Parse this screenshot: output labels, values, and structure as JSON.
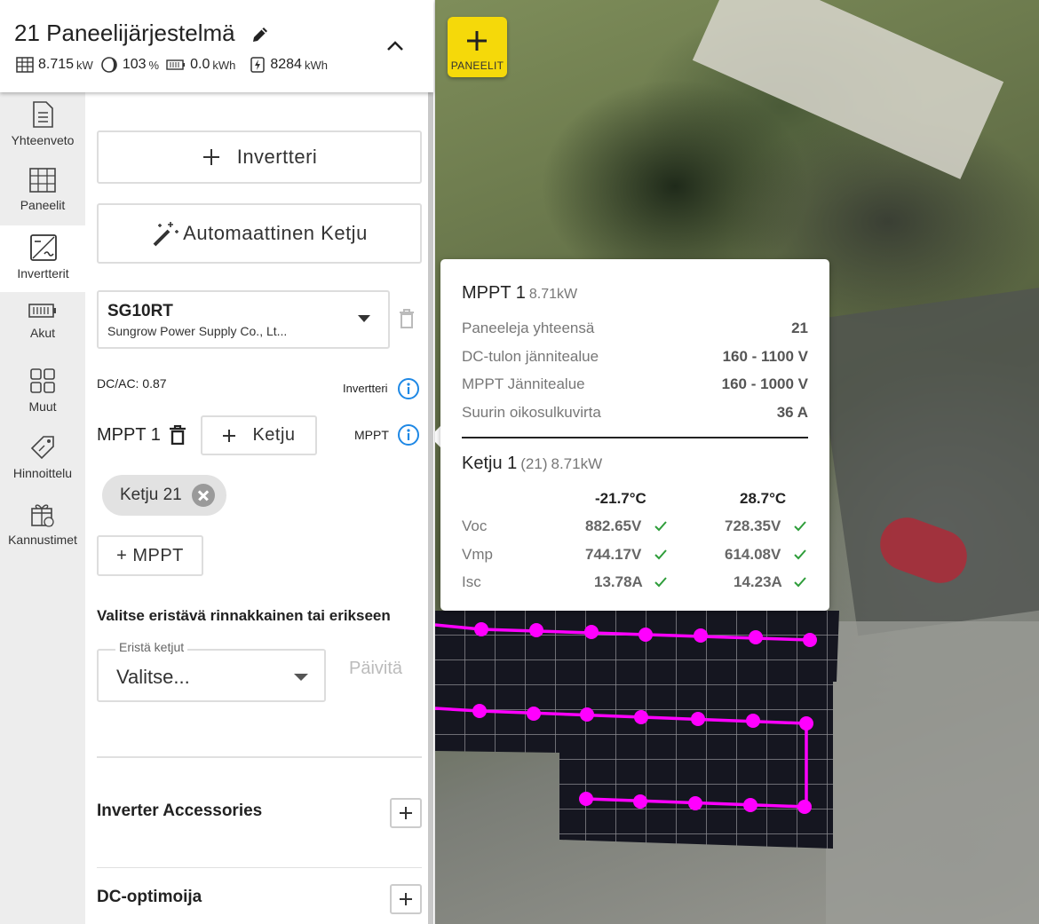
{
  "header": {
    "title": "21 Paneelijärjestelmä",
    "stats": [
      {
        "icon": "panel-grid-icon",
        "value": "8.715",
        "unit": "kW"
      },
      {
        "icon": "ratio-icon",
        "value": "103",
        "unit": "%"
      },
      {
        "icon": "battery-icon",
        "value": "0.0",
        "unit": "kWh"
      },
      {
        "icon": "energy-icon",
        "value": "8284",
        "unit": "kWh"
      }
    ]
  },
  "nav": {
    "items": [
      {
        "label": "Yhteenveto",
        "icon": "document-icon"
      },
      {
        "label": "Paneelit",
        "icon": "panel-grid-icon"
      },
      {
        "label": "Invertterit",
        "icon": "inverter-icon",
        "active": true
      },
      {
        "label": "Akut",
        "icon": "battery-icon"
      },
      {
        "label": "Muut",
        "icon": "grid-plus-icon"
      },
      {
        "label": "Hinnoittelu",
        "icon": "price-tag-icon"
      },
      {
        "label": "Kannustimet",
        "icon": "gift-icon"
      }
    ]
  },
  "content": {
    "add_inverter_label": "Invertteri",
    "auto_string_label": "Automaattinen Ketju",
    "inverter": {
      "name": "SG10RT",
      "manufacturer": "Sungrow Power Supply Co., Lt..."
    },
    "dc_ac": "DC/AC: 0.87",
    "inverter_info_label": "Invertteri",
    "mppt_label": "MPPT 1",
    "add_string_label": "Ketju",
    "mppt_info_label": "MPPT",
    "string_chip": "Ketju 21",
    "add_mppt_label": "+ MPPT",
    "isolation_title": "Valitse eristävä rinnakkainen tai erikseen",
    "isolation_field_label": "Eristä ketjut",
    "isolation_placeholder": "Valitse...",
    "update_label": "Päivitä",
    "accessories_title": "Inverter Accessories",
    "optimizer_title": "DC-optimoija"
  },
  "map": {
    "panels_button_label": "PANEELIT",
    "accent": "#f5d90a",
    "string_color": "#ff00ff"
  },
  "popup": {
    "title": "MPPT 1",
    "title_power": "8.71kW",
    "rows": [
      {
        "label": "Paneeleja yhteensä",
        "value": "21"
      },
      {
        "label": "DC-tulon jännitealue",
        "value": "160 - 1100 V"
      },
      {
        "label": "MPPT Jännitealue",
        "value": "160 - 1000 V"
      },
      {
        "label": "Suurin oikosulkuvirta",
        "value": "36 A"
      }
    ],
    "string_title": "Ketju 1",
    "string_count": "(21)",
    "string_power": "8.71kW",
    "temps": [
      "-21.7°C",
      "28.7°C"
    ],
    "table": [
      {
        "label": "Voc",
        "cold": "882.65V",
        "hot": "728.35V"
      },
      {
        "label": "Vmp",
        "cold": "744.17V",
        "hot": "614.08V"
      },
      {
        "label": "Isc",
        "cold": "13.78A",
        "hot": "14.23A"
      }
    ],
    "ok_color": "#2e9d3a"
  }
}
